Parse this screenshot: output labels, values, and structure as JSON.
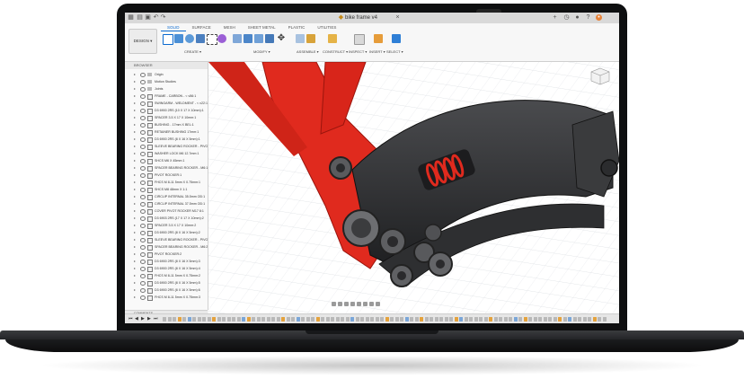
{
  "app": {
    "document_title": "bike frame v4"
  },
  "colors": {
    "accent": "#0a6ad0",
    "frame_red": "#e02a1e",
    "carbon_dark": "#2a2b2d"
  },
  "ribbon": {
    "workspace_button": "DESIGN ▾",
    "tabs": [
      "SOLID",
      "SURFACE",
      "MESH",
      "SHEET METAL",
      "PLASTIC",
      "UTILITIES"
    ],
    "active_tab": "SOLID",
    "groups": [
      "CREATE ▾",
      "MODIFY ▾",
      "ASSEMBLE ▾",
      "CONSTRUCT ▾",
      "INSPECT ▾",
      "INSERT ▾",
      "SELECT ▾"
    ]
  },
  "browser": {
    "header": "BROWSER",
    "comments_label": "COMMENTS",
    "items": [
      {
        "label": "Origin",
        "kind": "folder"
      },
      {
        "label": "Motion Studies",
        "kind": "folder"
      },
      {
        "label": "Joints",
        "kind": "folder"
      },
      {
        "label": "FRAME - CARBON - < v56:1",
        "kind": "component"
      },
      {
        "label": "SWINGARM - WELDMENT - < v22:1",
        "kind": "component"
      },
      {
        "label": "D3 6900 2RS (10 X 17 X 10mm):1",
        "kind": "component"
      },
      {
        "label": "SPACER 3.5 X 17 X 10mm:1",
        "kind": "component"
      },
      {
        "label": "BUSHING - 17mm X BEL:1",
        "kind": "component"
      },
      {
        "label": "RETAINER BUSHING 17mm:1",
        "kind": "component"
      },
      {
        "label": "D3 6900 2RS (8 X 16 X 5mm):1",
        "kind": "component"
      },
      {
        "label": "SLEEVE BEARING ROCKER - PIVO:1",
        "kind": "component"
      },
      {
        "label": "WASHER LOCK M6 12.7mm:1",
        "kind": "component"
      },
      {
        "label": "SHCS M6 X 45mm:1",
        "kind": "component"
      },
      {
        "label": "SPACER BEARING ROCKER - M6:1",
        "kind": "component"
      },
      {
        "label": "PIVOT ROCKER:1",
        "kind": "component"
      },
      {
        "label": "FHCS M 8-11 5mm X 0.75mm:1",
        "kind": "component"
      },
      {
        "label": "SHCS M8 48mm X 1:1",
        "kind": "component"
      },
      {
        "label": "CIRCLIP INTERNAL 35.5mm OD:1",
        "kind": "component"
      },
      {
        "label": "CIRCLIP INTERNAL 37.5mm OD:1",
        "kind": "component"
      },
      {
        "label": "COVER PIVOT ROCKER M17 8:1",
        "kind": "component"
      },
      {
        "label": "D3 6903 2RS (17 X 17 X 10mm):2",
        "kind": "component"
      },
      {
        "label": "SPACER 3.5 X 17 X 10mm:2",
        "kind": "component"
      },
      {
        "label": "D3 6900 2RS (8 X 16 X 5mm):2",
        "kind": "component"
      },
      {
        "label": "SLEEVE BEARING ROCKER - PIVO:2",
        "kind": "component"
      },
      {
        "label": "SPACER BEARING ROCKER - M6:2",
        "kind": "component"
      },
      {
        "label": "PIVOT ROCKER:2",
        "kind": "component"
      },
      {
        "label": "D3 6900 2RS (8 X 16 X 5mm):3",
        "kind": "component"
      },
      {
        "label": "D3 6900 2RS (8 X 16 X 5mm):4",
        "kind": "component"
      },
      {
        "label": "FHCS M 8-11 5mm X 0.75mm:2",
        "kind": "component"
      },
      {
        "label": "D3 6900 2RS (8 X 16 X 5mm):5",
        "kind": "component"
      },
      {
        "label": "D3 6900 2RS (8 X 16 X 5mm):6",
        "kind": "component"
      },
      {
        "label": "FHCS M 8-11 5mm X 0.75mm:3",
        "kind": "component"
      }
    ]
  },
  "timeline": {
    "controls": [
      "⏮",
      "◀",
      "▶",
      "▶",
      "⏭"
    ]
  },
  "icons": [
    "apps-grid-icon",
    "file-icon",
    "save-icon",
    "undo-icon",
    "redo-icon",
    "close-tab-icon",
    "add-tab-icon",
    "user-icon",
    "help-icon",
    "view-cube-icon"
  ]
}
